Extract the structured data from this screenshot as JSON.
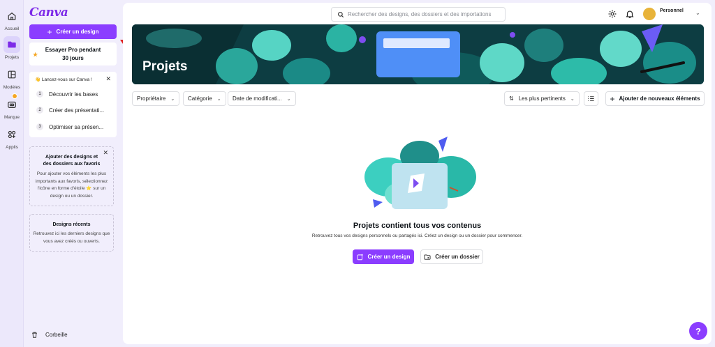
{
  "rail": {
    "items": [
      {
        "label": "Accueil",
        "icon": "home-icon"
      },
      {
        "label": "Projets",
        "icon": "folder-icon"
      },
      {
        "label": "Modèles",
        "icon": "templates-icon"
      },
      {
        "label": "Marque",
        "icon": "brand-icon"
      },
      {
        "label": "Applis",
        "icon": "apps-icon"
      }
    ]
  },
  "panel": {
    "logo": "Canva",
    "create_button": "Créer un design",
    "pro_card": {
      "line1": "Essayer Pro pendant",
      "line2": "30 jours"
    },
    "onboarding": {
      "title": "Lancez-vous sur Canva !",
      "steps": [
        {
          "num": "1",
          "label": "Découvrir les bases"
        },
        {
          "num": "2",
          "label": "Créer des présentati..."
        },
        {
          "num": "3",
          "label": "Optimiser sa présen..."
        }
      ]
    },
    "favorites": {
      "title_line1": "Ajouter des designs et",
      "title_line2": "des dossiers aux favoris",
      "body": "Pour ajouter vos éléments les plus importants aux favoris, sélectionnez l'icône en forme d'étoile ⭐ sur un design ou un dossier."
    },
    "recent": {
      "title": "Designs récents",
      "body": "Retrouvez ici les derniers designs que vous avez créés ou ouverts."
    },
    "trash": "Corbeille"
  },
  "header": {
    "search_placeholder": "Rechercher des designs, des dossiers et des importations",
    "account_label": "Personnel"
  },
  "banner": {
    "title": "Projets"
  },
  "filters": {
    "owner": "Propriétaire",
    "category": "Catégorie",
    "modified": "Date de modificati...",
    "sort": "Les plus pertinents",
    "add_new": "Ajouter de nouveaux éléments"
  },
  "empty_state": {
    "title": "Projets contient tous vos contenus",
    "subtitle": "Retrouvez tous vos designs personnels ou partagés ici. Créez un design ou un dossier pour commencer.",
    "create_design": "Créer un design",
    "create_folder": "Créer un dossier"
  },
  "help_button": "?",
  "colors": {
    "accent": "#8b3dff",
    "brand": "#7d2ae8",
    "annotation": "#e02020"
  }
}
